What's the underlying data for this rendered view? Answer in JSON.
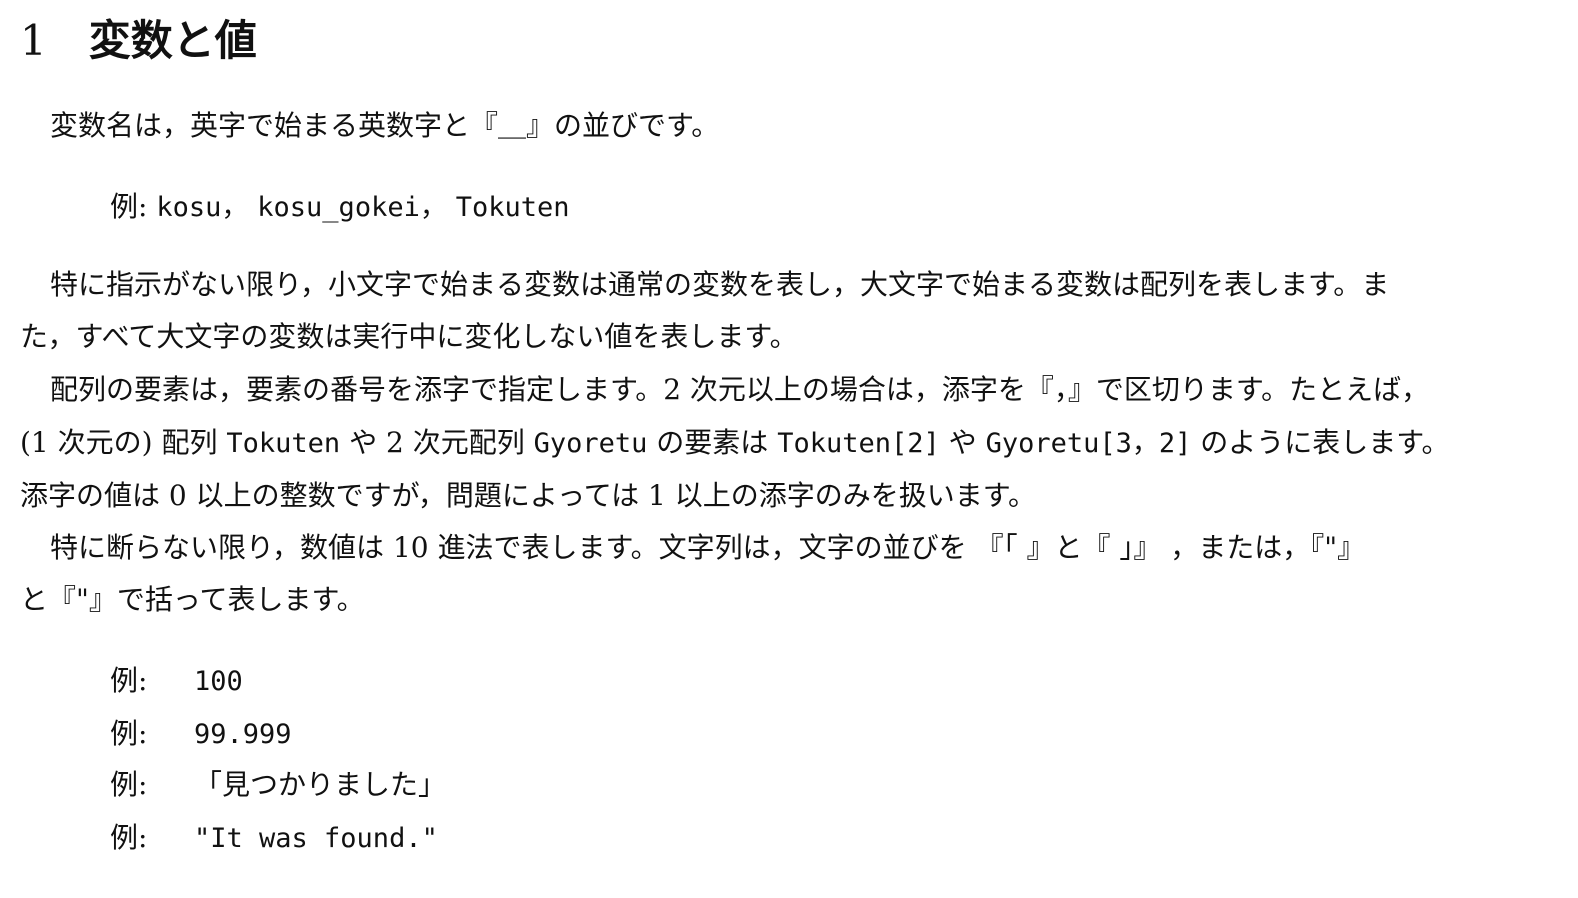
{
  "section": {
    "number": "1",
    "title": "変数と値"
  },
  "para1": {
    "text": "変数名は，英字で始まる英数字と『＿』の並びです。"
  },
  "example1": {
    "label": "例:",
    "items": [
      "kosu，",
      "kosu_gokei，",
      "Tokuten"
    ]
  },
  "para2": {
    "line1": "特に指示がない限り，小文字で始まる変数は通常の変数を表し，大文字で始まる変数は配列を表します。ま",
    "line2": "た，すべて大文字の変数は実行中に変化しない値を表します。"
  },
  "para3": {
    "line1": "配列の要素は，要素の番号を添字で指定します。2 次元以上の場合は，添字を『，』で区切ります。たとえば，",
    "line2_a": "(1 次元の) 配列 ",
    "line2_code1": "Tokuten",
    "line2_b": " や 2 次元配列 ",
    "line2_code2": "Gyoretu",
    "line2_c": " の要素は ",
    "line2_code3": "Tokuten[2]",
    "line2_d": " や ",
    "line2_code4": "Gyoretu[3，2]",
    "line2_e": " のように表します。",
    "line3": "添字の値は 0 以上の整数ですが，問題によっては 1 以上の添字のみを扱います。"
  },
  "para4": {
    "line1": "特に断らない限り，数値は 10 進法で表します。文字列は，文字の並びを 『「 』と『 」』 ，または，『\"』",
    "line2": "と『\"』で括って表します。"
  },
  "examples2": [
    {
      "label": "例:",
      "value": "100"
    },
    {
      "label": "例:",
      "value": "99.999"
    },
    {
      "label": "例:",
      "value": "「見つかりました」"
    },
    {
      "label": "例:",
      "value": "\"It was found.\""
    }
  ]
}
